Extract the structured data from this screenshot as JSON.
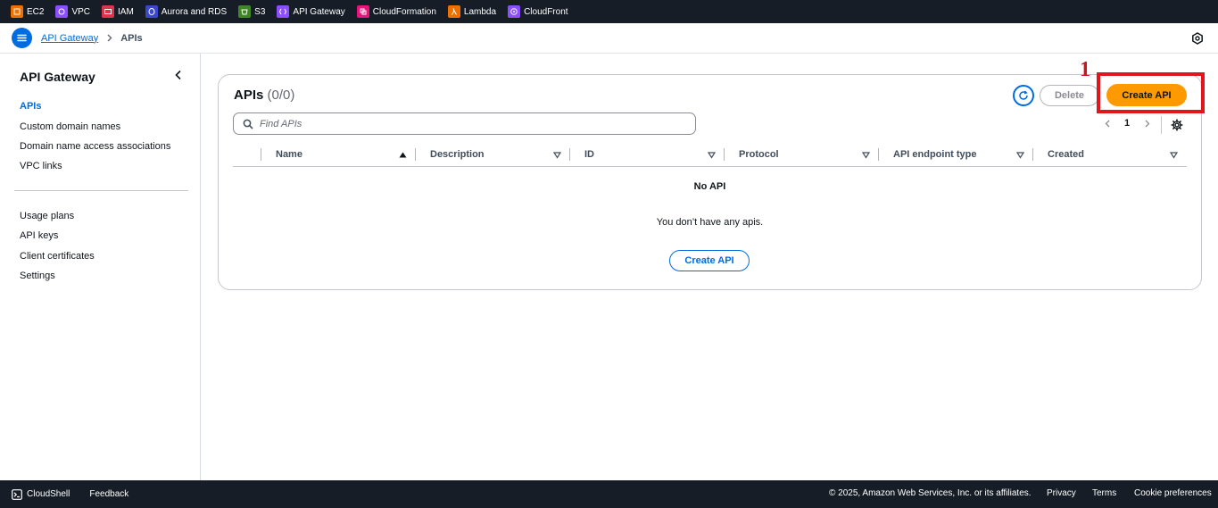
{
  "service_bar": {
    "items": [
      {
        "label": "EC2",
        "icon": "ec2-icon",
        "color": "#ed7100"
      },
      {
        "label": "VPC",
        "icon": "vpc-icon",
        "color": "#8c4fff"
      },
      {
        "label": "IAM",
        "icon": "iam-icon",
        "color": "#dd344c"
      },
      {
        "label": "Aurora and RDS",
        "icon": "rds-icon",
        "color": "#3b48cc"
      },
      {
        "label": "S3",
        "icon": "s3-icon",
        "color": "#3f8624"
      },
      {
        "label": "API Gateway",
        "icon": "api-gateway-icon",
        "color": "#8c4fff"
      },
      {
        "label": "CloudFormation",
        "icon": "cloudformation-icon",
        "color": "#e7157b"
      },
      {
        "label": "Lambda",
        "icon": "lambda-icon",
        "color": "#ed7100"
      },
      {
        "label": "CloudFront",
        "icon": "cloudfront-icon",
        "color": "#8c4fff"
      }
    ]
  },
  "breadcrumb": {
    "parent": "API Gateway",
    "current": "APIs"
  },
  "sidebar": {
    "title": "API Gateway",
    "items": [
      {
        "label": "APIs",
        "active": true
      },
      {
        "label": "Custom domain names"
      },
      {
        "label": "Domain name access associations"
      },
      {
        "label": "VPC links"
      }
    ],
    "items2": [
      {
        "label": "Usage plans"
      },
      {
        "label": "API keys"
      },
      {
        "label": "Client certificates"
      },
      {
        "label": "Settings"
      }
    ]
  },
  "main": {
    "title": "APIs",
    "count": "(0/0)",
    "delete_label": "Delete",
    "create_label": "Create API",
    "search_placeholder": "Find APIs",
    "page": "1",
    "columns": [
      "Name",
      "Description",
      "ID",
      "Protocol",
      "API endpoint type",
      "Created"
    ],
    "empty_title": "No API",
    "empty_desc": "You don’t have any apis.",
    "empty_create_label": "Create API"
  },
  "annotation": {
    "number": "1",
    "color": "#e0161c"
  },
  "footer": {
    "cloudshell": "CloudShell",
    "feedback": "Feedback",
    "copyright": "© 2025, Amazon Web Services, Inc. or its affiliates.",
    "privacy": "Privacy",
    "terms": "Terms",
    "cookies": "Cookie preferences"
  },
  "colors": {
    "accent": "#006ce0",
    "primary_button": "#ff9900",
    "nav_bg": "#161d26"
  }
}
